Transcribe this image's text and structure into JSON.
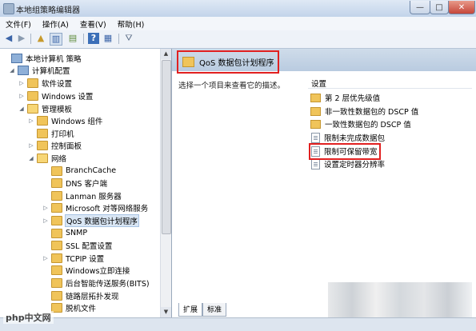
{
  "window": {
    "title": "本地组策略编辑器",
    "min": "—",
    "max": "□",
    "close": "✕"
  },
  "menu": [
    "文件(F)",
    "操作(A)",
    "查看(V)",
    "帮助(H)"
  ],
  "tree": [
    {
      "label": "本地计算机 策略",
      "toggle": "",
      "type": "computer"
    },
    {
      "label": "计算机配置",
      "toggle": "◢",
      "type": "computer"
    },
    {
      "label": "软件设置",
      "toggle": "▷",
      "type": "folder"
    },
    {
      "label": "Windows 设置",
      "toggle": "▷",
      "type": "folder"
    },
    {
      "label": "管理模板",
      "toggle": "◢",
      "type": "folder-open"
    },
    {
      "label": "Windows 组件",
      "toggle": "▷",
      "type": "folder"
    },
    {
      "label": "打印机",
      "toggle": "",
      "type": "folder"
    },
    {
      "label": "控制面板",
      "toggle": "▷",
      "type": "folder"
    },
    {
      "label": "网络",
      "toggle": "◢",
      "type": "folder-open"
    },
    {
      "label": "BranchCache",
      "toggle": "",
      "type": "folder"
    },
    {
      "label": "DNS 客户端",
      "toggle": "",
      "type": "folder"
    },
    {
      "label": "Lanman 服务器",
      "toggle": "",
      "type": "folder"
    },
    {
      "label": "Microsoft 对等网络服务",
      "toggle": "▷",
      "type": "folder"
    },
    {
      "label": "QoS 数据包计划程序",
      "toggle": "▷",
      "type": "folder",
      "selected": true
    },
    {
      "label": "SNMP",
      "toggle": "",
      "type": "folder"
    },
    {
      "label": "SSL 配置设置",
      "toggle": "",
      "type": "folder"
    },
    {
      "label": "TCPIP 设置",
      "toggle": "▷",
      "type": "folder"
    },
    {
      "label": "Windows立即连接",
      "toggle": "",
      "type": "folder"
    },
    {
      "label": "后台智能传送服务(BITS)",
      "toggle": "",
      "type": "folder"
    },
    {
      "label": "链路层拓扑发现",
      "toggle": "",
      "type": "folder"
    },
    {
      "label": "脱机文件",
      "toggle": "",
      "type": "folder"
    }
  ],
  "right": {
    "header_title": "QoS 数据包计划程序",
    "description": "选择一个项目来查看它的描述。",
    "column_header": "设置",
    "settings": [
      {
        "label": "第 2 层优先级值",
        "type": "folder"
      },
      {
        "label": "非一致性数据包的 DSCP 值",
        "type": "folder"
      },
      {
        "label": "一致性数据包的 DSCP 值",
        "type": "folder"
      },
      {
        "label": "限制未完成数据包",
        "type": "policy"
      },
      {
        "label": "限制可保留带宽",
        "type": "policy"
      },
      {
        "label": "设置定时器分辨率",
        "type": "policy"
      }
    ],
    "tabs": [
      "扩展",
      "标准"
    ]
  },
  "watermark": "php中文网"
}
